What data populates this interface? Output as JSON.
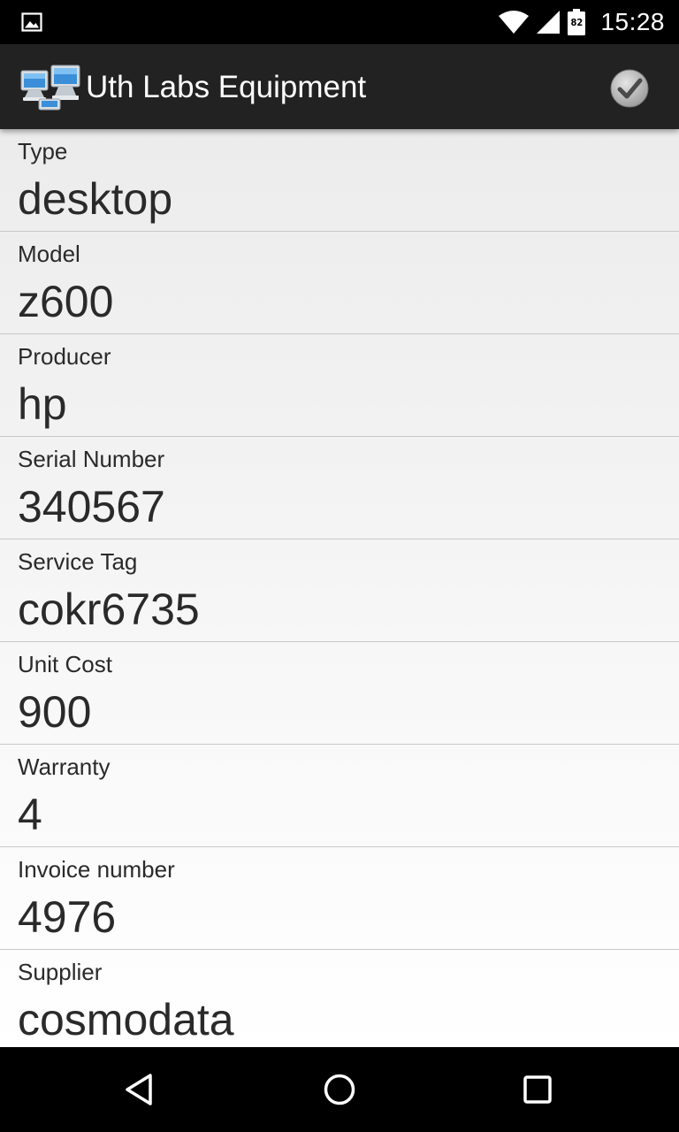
{
  "status_bar": {
    "time": "15:28",
    "battery_level": "82",
    "icons": [
      "gallery-notification-icon",
      "wifi-icon",
      "cell-signal-icon",
      "battery-icon"
    ]
  },
  "action_bar": {
    "title": "Uth Labs Equipment",
    "app_icon": "networked-computers-icon",
    "done_icon": "checkmark-icon"
  },
  "fields": [
    {
      "label": "Type",
      "value": "desktop"
    },
    {
      "label": "Model",
      "value": "z600"
    },
    {
      "label": "Producer",
      "value": "hp"
    },
    {
      "label": "Serial Number",
      "value": "340567"
    },
    {
      "label": "Service Tag",
      "value": "cokr6735"
    },
    {
      "label": "Unit Cost",
      "value": "900"
    },
    {
      "label": "Warranty",
      "value": "4"
    },
    {
      "label": "Invoice number",
      "value": "4976"
    },
    {
      "label": "Supplier",
      "value": "cosmodata"
    }
  ],
  "nav_bar": {
    "icons": [
      "back-icon",
      "home-icon",
      "recents-icon"
    ]
  },
  "colors": {
    "status_bar_bg": "#000000",
    "action_bar_bg": "#222222",
    "row_gradient_top": "#ececec",
    "row_gradient_bottom": "#ffffff",
    "text": "#2a2a2a",
    "divider": "#c8c8c8"
  }
}
